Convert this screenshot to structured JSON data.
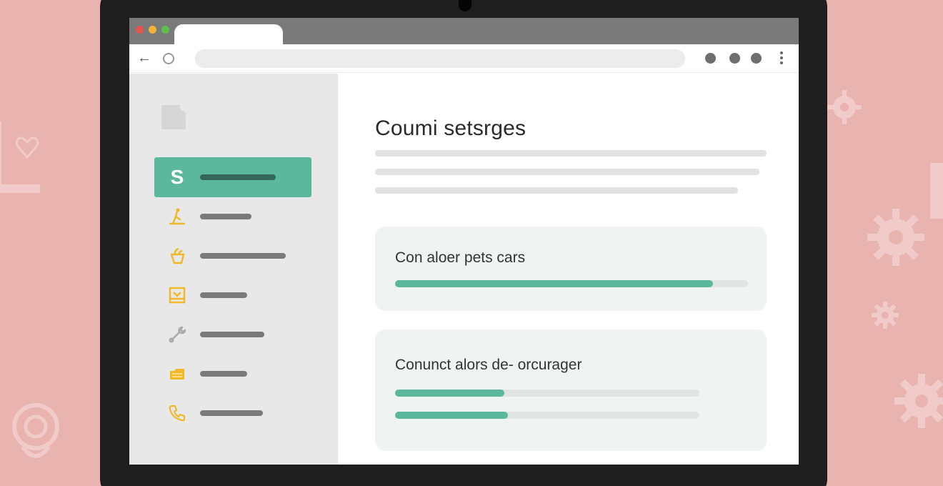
{
  "icons": {
    "background": [
      "heart-outline-icon",
      "knot-icon",
      "gear-icon"
    ],
    "browser": [
      "back-arrow-icon",
      "reload-icon",
      "kebab-menu-icon"
    ],
    "sidebar": [
      "app-logo-icon",
      "s-letter-icon",
      "figure-icon",
      "cup-icon",
      "box-icon",
      "wrench-icon",
      "folder-icon",
      "phone-icon"
    ]
  },
  "colors": {
    "background": "#e9b3b0",
    "accent": "#5cb89d",
    "sidebar_icon": "#f0b92b",
    "card_bg": "#eff4f2"
  },
  "browser": {
    "back_glyph": "←"
  },
  "sidebar": {
    "active_item_letter": "S"
  },
  "main": {
    "title": "Coumi setsrges",
    "cards": [
      {
        "label": "Con aloer pets cars",
        "progress": [
          0.9
        ]
      },
      {
        "label": "Conunct alors de- orcurager",
        "progress": [
          0.36,
          0.37
        ]
      }
    ]
  }
}
